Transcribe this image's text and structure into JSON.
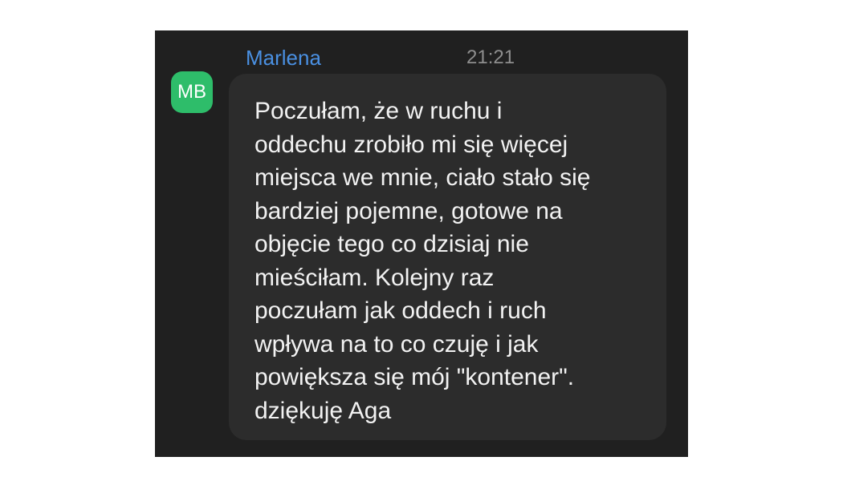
{
  "message": {
    "sender_name": "Marlena",
    "time": "21:21",
    "avatar_initials": "MB",
    "avatar_color": "#2ebd6a",
    "name_color": "#4a90e2",
    "lines": [
      "Poczułam, że w ruchu i",
      "oddechu zrobiło mi się więcej",
      "miejsca we mnie, ciało stało się",
      "bardziej pojemne, gotowe na",
      "objęcie tego co dzisiaj nie",
      "mieściłam. Kolejny raz",
      "poczułam jak oddech i ruch",
      "wpływa na to co czuję i jak",
      "powiększa się mój \"kontener\".",
      "dziękuję Aga"
    ]
  }
}
